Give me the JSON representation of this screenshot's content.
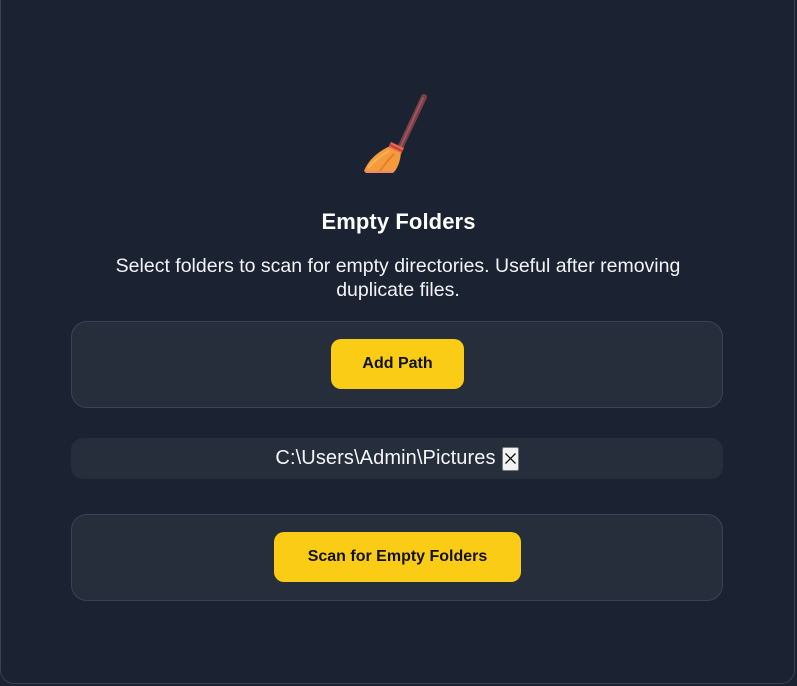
{
  "header": {
    "icon": "broom-icon",
    "title": "Empty Folders",
    "subtitle": "Select folders to scan for empty directories. Useful after removing duplicate files."
  },
  "add_card": {
    "button_label": "Add Path"
  },
  "paths": [
    {
      "path": "C:\\Users\\Admin\\Pictures",
      "remove_icon": "close-icon"
    }
  ],
  "scan_card": {
    "button_label": "Scan for Empty Folders"
  },
  "colors": {
    "background": "#1b2232",
    "card": "#262e3c",
    "accent": "#facc15",
    "text": "#ffffff"
  }
}
